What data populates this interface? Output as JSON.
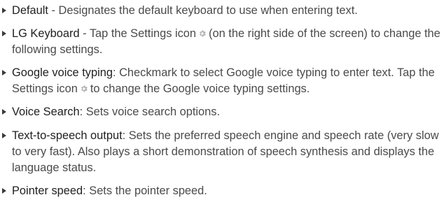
{
  "items": [
    {
      "term": "Default",
      "desc": " - Designates the default keyboard to use when entering text."
    },
    {
      "term": "LG Keyboard",
      "desc_before_icon": " - Tap the Settings icon",
      "icon": "settings-gear-icon",
      "desc_after_icon": "(on the right side of the screen) to change the following settings."
    },
    {
      "term": "Google voice typing",
      "desc_before_icon": ": Checkmark to select Google voice typing to enter text. Tap the Settings icon",
      "icon": "settings-gear-icon",
      "desc_after_icon": "to change the Google voice typing settings."
    },
    {
      "term": "Voice Search",
      "desc": ": Sets voice search options."
    },
    {
      "term": "Text-to-speech output",
      "desc": ": Sets the preferred speech engine and speech rate (very slow to very fast). Also plays a short demonstration of speech synthesis and displays the language status."
    },
    {
      "term": "Pointer speed",
      "desc": ": Sets the pointer speed."
    }
  ],
  "colors": {
    "body_text": "#4a4a4a",
    "term_text": "#1f1f1f",
    "bullet": "#3a3a3a",
    "icon": "#b0b0b0"
  }
}
